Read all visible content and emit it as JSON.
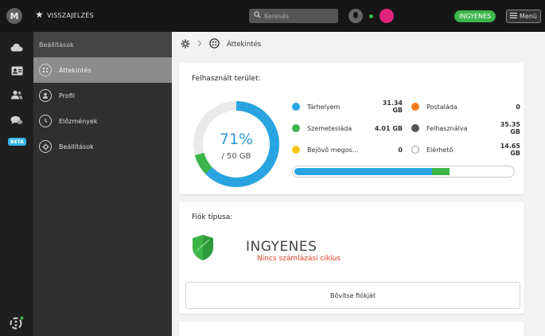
{
  "topbar": {
    "logo": "M",
    "back_label": "VISSZAJELZÉS",
    "search_placeholder": "Keresés",
    "plan_badge": "INGYENES",
    "menu_label": "Menü"
  },
  "rail": {
    "beta_label": "BETA"
  },
  "sidebar": {
    "header": "Beállítások",
    "items": [
      {
        "label": "Áttekintés",
        "active": true
      },
      {
        "label": "Profil"
      },
      {
        "label": "Előzmények"
      },
      {
        "label": "Beállítások"
      }
    ]
  },
  "breadcrumb": {
    "current": "Áttekintés"
  },
  "storage": {
    "title": "Felhasznált terület:",
    "percent_label": "71%",
    "total_label": "/ 50 GB",
    "used_fraction": 0.71,
    "legend": [
      {
        "label": "Tárhelyem",
        "value": "31.34 GB",
        "color": "#29a4e0",
        "icon": "filled-dot"
      },
      {
        "label": "Postaláda",
        "value": "0",
        "color": "#f47b20",
        "icon": "filled-dot"
      },
      {
        "label": "Szemetesláda",
        "value": "4.01 GB",
        "color": "#3db54a",
        "icon": "filled-dot"
      },
      {
        "label": "Felhasználva",
        "value": "35.35 GB",
        "color": "#555555",
        "icon": "filled-dot"
      },
      {
        "label": "Bejövő megos…",
        "value": "0",
        "color": "#f5c518",
        "icon": "filled-dot"
      },
      {
        "label": "Elérhető",
        "value": "14.65 GB",
        "color": "#ffffff",
        "icon": "hollow-dot"
      }
    ],
    "bar": [
      {
        "name": "Tárhelyem",
        "gb": 31.34,
        "color": "#29a4e0"
      },
      {
        "name": "Szemetesláda",
        "gb": 4.01,
        "color": "#3db54a"
      }
    ],
    "total_gb": 50
  },
  "account": {
    "title": "Fiók típusa:",
    "plan": "INGYENES",
    "subtitle": "Nincs számlázási ciklus",
    "shield_color": "#3db54a",
    "upgrade_label": "Bővítse fiókját"
  }
}
